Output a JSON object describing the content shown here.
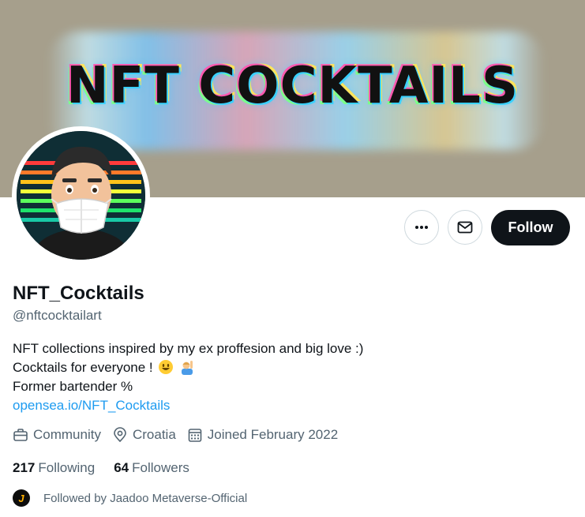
{
  "banner": {
    "text": "NFT COCKTAILS"
  },
  "profile": {
    "display_name": "NFT_Cocktails",
    "handle": "@nftcocktailart",
    "bio_line1": "NFT collections inspired by my ex proffesion and big love :)",
    "bio_line2": "Cocktails for everyone !",
    "bio_line3": "Former bartender %",
    "link": "opensea.io/NFT_Cocktails"
  },
  "actions": {
    "more_icon": "more-horizontal-icon",
    "message_icon": "envelope-icon",
    "follow_label": "Follow"
  },
  "meta": {
    "category": "Community",
    "location": "Croatia",
    "joined": "Joined February 2022"
  },
  "stats": {
    "following_count": "217",
    "following_label": "Following",
    "followers_count": "64",
    "followers_label": "Followers"
  },
  "followed_by": {
    "avatar_letter": "J",
    "text": "Followed by Jaadoo Metaverse-Official"
  },
  "colors": {
    "accent": "#1d9bf0",
    "text_primary": "#0f1419",
    "text_secondary": "#536471",
    "banner_bg": "#a69f8c"
  }
}
